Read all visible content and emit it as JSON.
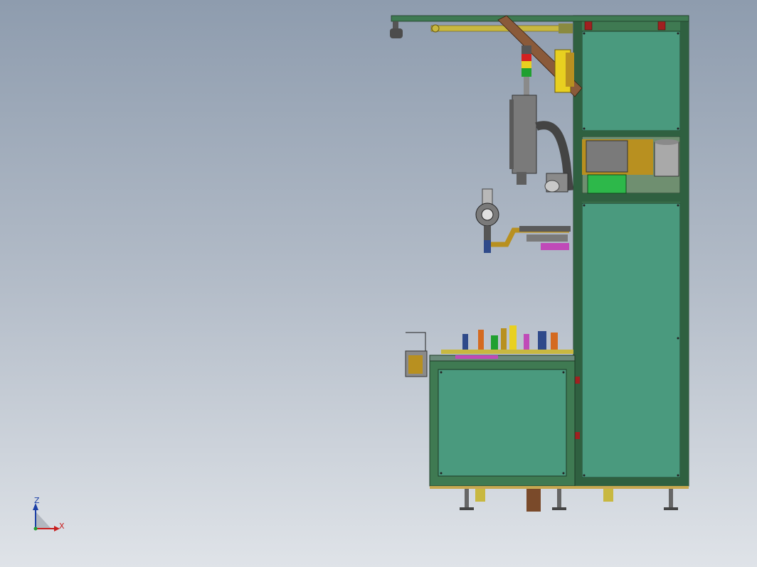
{
  "window": {
    "type": "CAD 3D viewport (side elevation of automation machine)"
  },
  "triad": {
    "z_label": "Z",
    "x_label": "X",
    "z_color": "#1b3fa6",
    "x_color": "#c81e1e"
  },
  "colors": {
    "background_top": "#8e9cae",
    "background_bottom": "#dfe3e8",
    "frame_profile": "#3f7a52",
    "panel_fill": "#4a9a7e",
    "brace": "#8a5a3a",
    "cylinder": "#c8b840",
    "gray_part": "#7a7a7a",
    "gold_part": "#b89020",
    "green_plate": "#2db84a",
    "magenta_part": "#c04ab8",
    "signal_red": "#d42020",
    "signal_yellow": "#e8d020",
    "signal_green": "#20a030"
  },
  "model_parts": [
    "frame",
    "upper-panel",
    "middle-panel",
    "lower-panel",
    "side-cabinet",
    "top-beam",
    "diagonal-brace",
    "signal-tower",
    "control-box",
    "motor-unit",
    "rotary-fixture",
    "gripper-arm",
    "work-table",
    "leveling-feet"
  ]
}
